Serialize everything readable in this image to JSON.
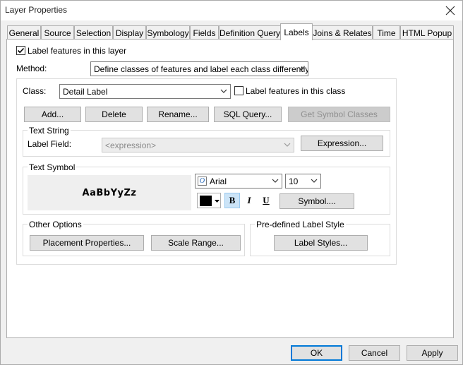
{
  "window": {
    "title": "Layer Properties"
  },
  "tabs": [
    {
      "label": "General"
    },
    {
      "label": "Source"
    },
    {
      "label": "Selection"
    },
    {
      "label": "Display"
    },
    {
      "label": "Symbology"
    },
    {
      "label": "Fields"
    },
    {
      "label": "Definition Query"
    },
    {
      "label": "Labels"
    },
    {
      "label": "Joins & Relates"
    },
    {
      "label": "Time"
    },
    {
      "label": "HTML Popup"
    }
  ],
  "active_tab": "Labels",
  "labels_tab": {
    "label_features_checkbox": {
      "label": "Label features in this layer",
      "checked": true
    },
    "method": {
      "label": "Method:",
      "value": "Define classes of features and label each class differently."
    },
    "class": {
      "label": "Class:",
      "value": "Detail Label"
    },
    "label_class_checkbox": {
      "label": "Label features in this class",
      "checked": false
    },
    "class_buttons": {
      "add": "Add...",
      "delete": "Delete",
      "rename": "Rename...",
      "sql_query": "SQL Query...",
      "get_symbol_classes": "Get Symbol Classes"
    },
    "text_string": {
      "title": "Text String",
      "label_field_label": "Label Field:",
      "label_field_value": "<expression>",
      "expression_button": "Expression..."
    },
    "text_symbol": {
      "title": "Text Symbol",
      "preview": "AaBbYyZz",
      "font": "Arial",
      "size": "10",
      "bold": "B",
      "italic": "I",
      "underline": "U",
      "symbol_button": "Symbol....",
      "color": "#000000"
    },
    "other_options": {
      "title": "Other Options",
      "placement_button": "Placement Properties...",
      "scale_range_button": "Scale Range..."
    },
    "predefined": {
      "title": "Pre-defined Label Style",
      "label_styles_button": "Label Styles..."
    }
  },
  "footer": {
    "ok": "OK",
    "cancel": "Cancel",
    "apply": "Apply"
  }
}
